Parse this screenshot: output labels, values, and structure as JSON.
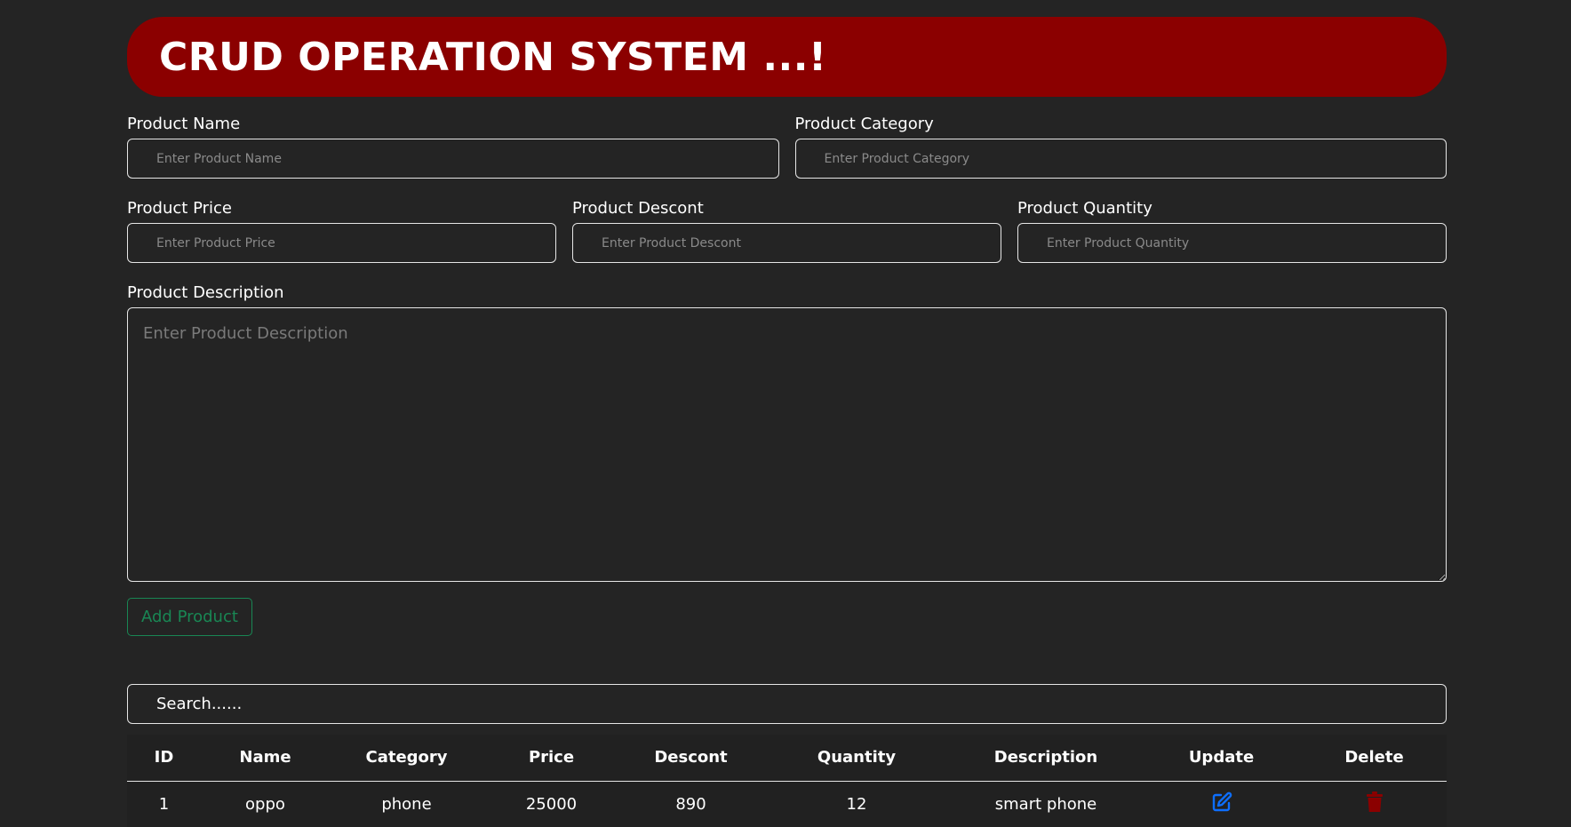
{
  "header": {
    "title": "CRUD OPERATION SYSTEM ...!"
  },
  "form": {
    "name": {
      "label": "Product Name",
      "placeholder": "Enter Product Name"
    },
    "category": {
      "label": "Product Category",
      "placeholder": "Enter Product Category"
    },
    "price": {
      "label": "Product Price",
      "placeholder": "Enter Product Price"
    },
    "descont": {
      "label": "Product Descont",
      "placeholder": "Enter Product Descont"
    },
    "quantity": {
      "label": "Product Quantity",
      "placeholder": "Enter Product Quantity"
    },
    "description": {
      "label": "Product Description",
      "placeholder": "Enter Product Description"
    },
    "add_button": "Add Product"
  },
  "search": {
    "placeholder": "Search......"
  },
  "table": {
    "headers": [
      "ID",
      "Name",
      "Category",
      "Price",
      "Descont",
      "Quantity",
      "Description",
      "Update",
      "Delete"
    ],
    "rows": [
      {
        "id": "1",
        "name": "oppo",
        "category": "phone",
        "price": "25000",
        "descont": "890",
        "quantity": "12",
        "description": "smart phone"
      }
    ]
  },
  "colors": {
    "background": "#242424",
    "banner": "#8b0000",
    "add_button": "#198754",
    "update_icon": "#0d6efd",
    "delete_icon": "#8b0000"
  },
  "icons": {
    "update": "edit-icon",
    "delete": "trash-icon"
  }
}
